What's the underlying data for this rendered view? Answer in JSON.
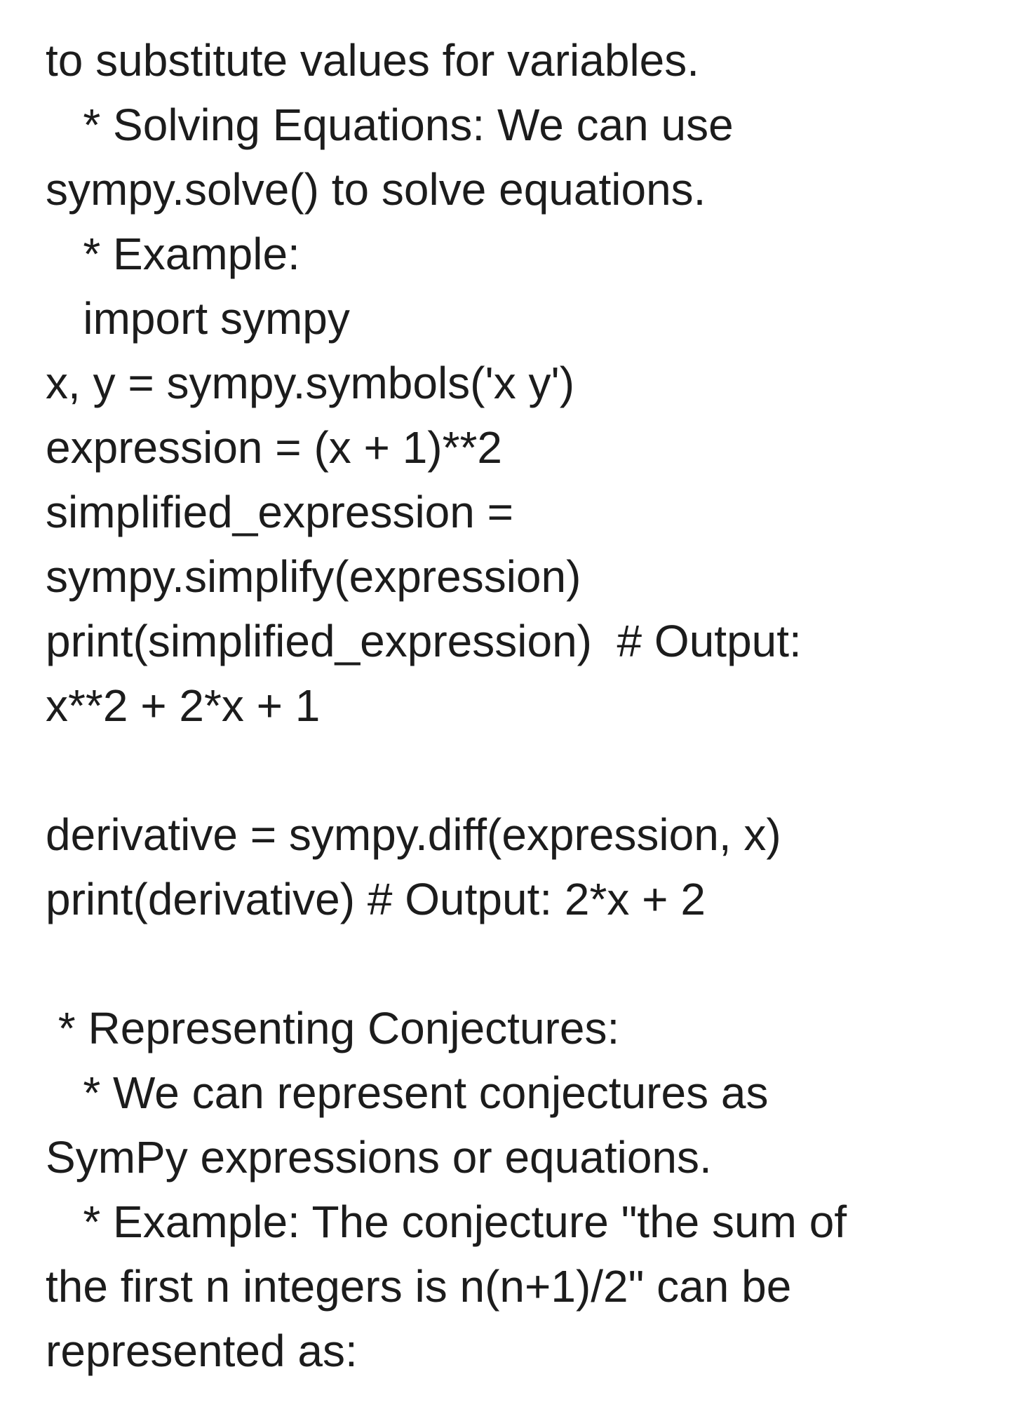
{
  "document": {
    "lines": [
      "to substitute values for variables.",
      "   * Solving Equations: We can use",
      "sympy.solve() to solve equations.",
      "   * Example:",
      "   import sympy",
      "x, y = sympy.symbols('x y')",
      "expression = (x + 1)**2",
      "simplified_expression =",
      "sympy.simplify(expression)",
      "print(simplified_expression)  # Output:",
      "x**2 + 2*x + 1",
      "",
      "derivative = sympy.diff(expression, x)",
      "print(derivative) # Output: 2*x + 2",
      "",
      " * Representing Conjectures:",
      "   * We can represent conjectures as",
      "SymPy expressions or equations.",
      "   * Example: The conjecture \"the sum of",
      "the first n integers is n(n+1)/2\" can be",
      "represented as:"
    ]
  }
}
